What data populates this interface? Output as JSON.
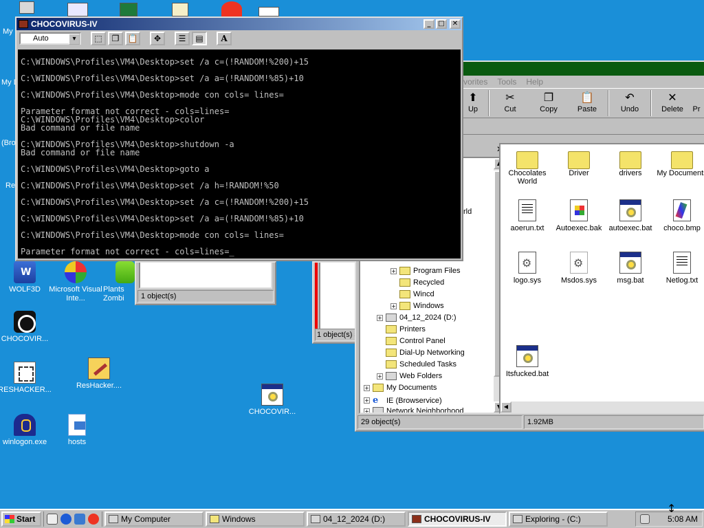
{
  "desktop": {
    "partial_labels": [
      "My",
      "My D",
      "(Bro",
      "Re"
    ],
    "icons": [
      {
        "label": "WOLF3D"
      },
      {
        "label": "Microsoft Visual Inte..."
      },
      {
        "label": "Plants Zombi"
      },
      {
        "label": "CHOCOVIR..."
      },
      {
        "label": "RESHACKER..."
      },
      {
        "label": "ResHacker...."
      },
      {
        "label": "CHOCOVIR..."
      },
      {
        "label": "winlogon.exe"
      },
      {
        "label": "hosts"
      }
    ]
  },
  "console": {
    "title": "CHOCOVIRUS-IV",
    "font_select": "Auto",
    "tool_letter": "A",
    "lines": [
      "",
      "C:\\WINDOWS\\Profiles\\VM4\\Desktop>set /a c=(!RANDOM!%200)+15",
      "",
      "C:\\WINDOWS\\Profiles\\VM4\\Desktop>set /a a=(!RANDOM!%85)+10",
      "",
      "C:\\WINDOWS\\Profiles\\VM4\\Desktop>mode con cols= lines=",
      "",
      "Parameter format not correct - cols=lines=",
      "C:\\WINDOWS\\Profiles\\VM4\\Desktop>color",
      "Bad command or file name",
      "",
      "C:\\WINDOWS\\Profiles\\VM4\\Desktop>shutdown -a",
      "Bad command or file name",
      "",
      "C:\\WINDOWS\\Profiles\\VM4\\Desktop>goto a",
      "",
      "C:\\WINDOWS\\Profiles\\VM4\\Desktop>set /a h=!RANDOM!%50",
      "",
      "C:\\WINDOWS\\Profiles\\VM4\\Desktop>set /a c=(!RANDOM!%200)+15",
      "",
      "C:\\WINDOWS\\Profiles\\VM4\\Desktop>set /a a=(!RANDOM!%85)+10",
      "",
      "C:\\WINDOWS\\Profiles\\VM4\\Desktop>mode con cols= lines=",
      "",
      "Parameter format not correct - cols=lines=_"
    ]
  },
  "bg_window": {
    "status": "1 object(s)",
    "status2": "1 object(s) s"
  },
  "explorer": {
    "menu": {
      "favorites": "vorites",
      "tools": "Tools",
      "help": "Help"
    },
    "toolbar": [
      "Up",
      "Cut",
      "Copy",
      "Paste",
      "Undo",
      "Delete",
      "Pr"
    ],
    "tree_partial": "rld",
    "tree": [
      {
        "label": "Program Files",
        "expander": "+"
      },
      {
        "label": "Recycled",
        "expander": ""
      },
      {
        "label": "Wincd",
        "expander": ""
      },
      {
        "label": "Windows",
        "expander": "+"
      },
      {
        "label": "04_12_2024 (D:)",
        "expander": "+"
      },
      {
        "label": "Printers",
        "expander": ""
      },
      {
        "label": "Control Panel",
        "expander": ""
      },
      {
        "label": "Dial-Up Networking",
        "expander": ""
      },
      {
        "label": "Scheduled Tasks",
        "expander": ""
      },
      {
        "label": "Web Folders",
        "expander": "+"
      },
      {
        "label": "My Documents",
        "expander": "+"
      },
      {
        "label": "IE (Browservice)",
        "expander": "+"
      },
      {
        "label": "Network Neighborhood",
        "expander": "+"
      }
    ],
    "files": [
      {
        "label": "Chocolates World",
        "type": "folder"
      },
      {
        "label": "Driver",
        "type": "folder"
      },
      {
        "label": "drivers",
        "type": "folder"
      },
      {
        "label": "My Documents",
        "type": "folder"
      },
      {
        "label": "aoerun.txt",
        "type": "doc"
      },
      {
        "label": "Autoexec.bak",
        "type": "bak"
      },
      {
        "label": "autoexec.bat",
        "type": "bat"
      },
      {
        "label": "choco.bmp",
        "type": "bmp"
      },
      {
        "label": "logo.sys",
        "type": "sys"
      },
      {
        "label": "Msdos.sys",
        "type": "sys"
      },
      {
        "label": "msg.bat",
        "type": "bat"
      },
      {
        "label": "Netlog.txt",
        "type": "doc"
      },
      {
        "label": "Itsfucked.bat",
        "type": "bat"
      }
    ],
    "status_objects": "29 object(s)",
    "status_size": "1.92MB"
  },
  "taskbar": {
    "start": "Start",
    "tasks": [
      {
        "label": "My Computer"
      },
      {
        "label": "Windows"
      },
      {
        "label": "04_12_2024 (D:)"
      },
      {
        "label": "CHOCOVIRUS-IV"
      },
      {
        "label": "Exploring - (C:)"
      }
    ],
    "clock": "5:08 AM"
  }
}
